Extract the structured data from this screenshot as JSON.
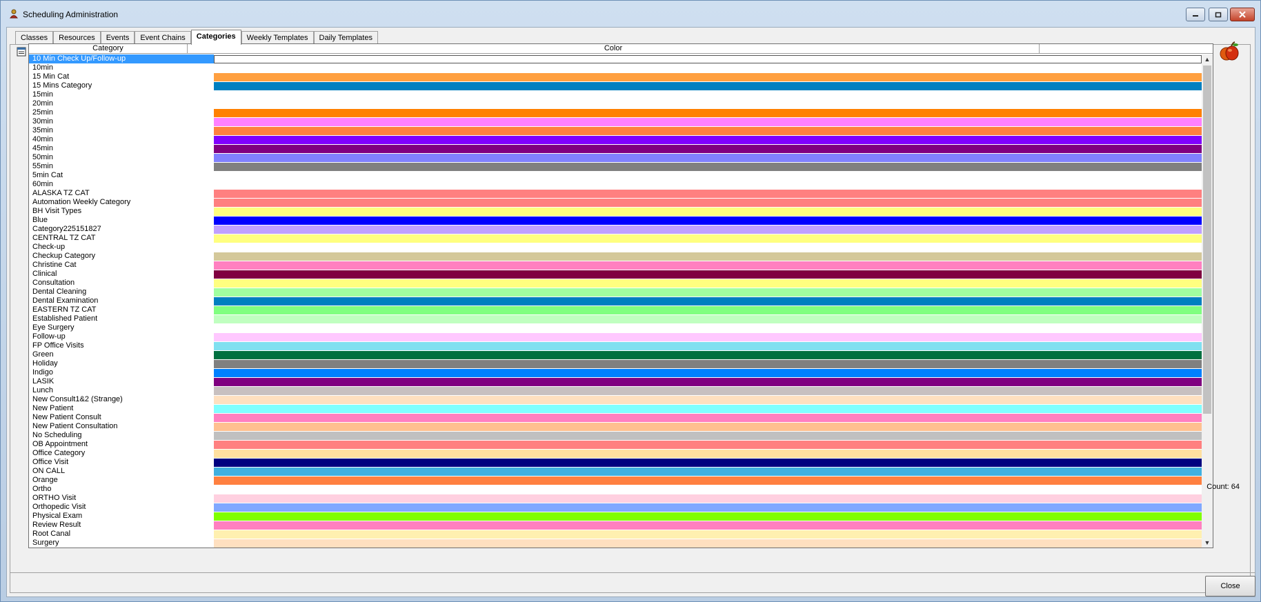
{
  "window": {
    "title": "Scheduling Administration"
  },
  "tabs": [
    {
      "label": "Classes",
      "active": false
    },
    {
      "label": "Resources",
      "active": false
    },
    {
      "label": "Events",
      "active": false
    },
    {
      "label": "Event Chains",
      "active": false
    },
    {
      "label": "Categories",
      "active": true
    },
    {
      "label": "Weekly Templates",
      "active": false
    },
    {
      "label": "Daily Templates",
      "active": false
    }
  ],
  "grid": {
    "columns": [
      "Category",
      "Color"
    ],
    "selected_index": 0,
    "rows": [
      {
        "name": "10 Min Check Up/Follow-up",
        "color": "#ffffff"
      },
      {
        "name": "10min",
        "color": "#ffffff"
      },
      {
        "name": "15 Min Cat",
        "color": "#ffa040"
      },
      {
        "name": "15 Mins Category",
        "color": "#0080c0"
      },
      {
        "name": "15min",
        "color": "#ffffff"
      },
      {
        "name": "20min",
        "color": "#ffffff"
      },
      {
        "name": "25min",
        "color": "#ff8000"
      },
      {
        "name": "30min",
        "color": "#ff80ff"
      },
      {
        "name": "35min",
        "color": "#ff8040"
      },
      {
        "name": "40min",
        "color": "#8000ff"
      },
      {
        "name": "45min",
        "color": "#800080"
      },
      {
        "name": "50min",
        "color": "#8080ff"
      },
      {
        "name": "55min",
        "color": "#808080"
      },
      {
        "name": "5min Cat",
        "color": "#ffffff"
      },
      {
        "name": "60min",
        "color": "#ffffff"
      },
      {
        "name": "ALASKA TZ CAT",
        "color": "#ff8080"
      },
      {
        "name": "Automation Weekly Category",
        "color": "#ff8080"
      },
      {
        "name": "BH Visit Types",
        "color": "#ffff80"
      },
      {
        "name": "Blue",
        "color": "#0000ff"
      },
      {
        "name": "Category225151827",
        "color": "#c0a0ff"
      },
      {
        "name": "CENTRAL TZ CAT",
        "color": "#ffff80"
      },
      {
        "name": "Check-up",
        "color": "#ffffff"
      },
      {
        "name": "Checkup Category",
        "color": "#d4c89a"
      },
      {
        "name": "Christine Cat",
        "color": "#ff80c0"
      },
      {
        "name": "Clinical",
        "color": "#800040"
      },
      {
        "name": "Consultation",
        "color": "#ffff80"
      },
      {
        "name": "Dental Cleaning",
        "color": "#a0ffa0"
      },
      {
        "name": "Dental Examination",
        "color": "#0080c0"
      },
      {
        "name": "EASTERN TZ CAT",
        "color": "#80ff80"
      },
      {
        "name": "Established Patient",
        "color": "#c0ffc0"
      },
      {
        "name": "Eye Surgery",
        "color": "#ffffff"
      },
      {
        "name": "Follow-up",
        "color": "#ffc8ff"
      },
      {
        "name": "FP Office Visits",
        "color": "#80e0f0"
      },
      {
        "name": "Green",
        "color": "#007040"
      },
      {
        "name": "Holiday",
        "color": "#808080"
      },
      {
        "name": "Indigo",
        "color": "#0080ff"
      },
      {
        "name": "LASIK",
        "color": "#800080"
      },
      {
        "name": "Lunch",
        "color": "#c8c0c0"
      },
      {
        "name": "New Consult1&2 (Strange)",
        "color": "#ffe0c0"
      },
      {
        "name": "New Patient",
        "color": "#80ffff"
      },
      {
        "name": "New Patient Consult",
        "color": "#ff80c0"
      },
      {
        "name": "New Patient Consultation",
        "color": "#ffc090"
      },
      {
        "name": "No Scheduling",
        "color": "#c0c0c0"
      },
      {
        "name": "OB Appointment",
        "color": "#ff8080"
      },
      {
        "name": "Office Category",
        "color": "#ffe0a0"
      },
      {
        "name": "Office Visit",
        "color": "#000080"
      },
      {
        "name": "ON CALL",
        "color": "#40b0e0"
      },
      {
        "name": "Orange",
        "color": "#ff8040"
      },
      {
        "name": "Ortho",
        "color": "#ffffff"
      },
      {
        "name": "ORTHO Visit",
        "color": "#ffd0e0"
      },
      {
        "name": "Orthopedic Visit",
        "color": "#80a8ff"
      },
      {
        "name": "Physical Exam",
        "color": "#80ff00"
      },
      {
        "name": "Review Result",
        "color": "#ff80c0"
      },
      {
        "name": "Root Canal",
        "color": "#fff0b0"
      },
      {
        "name": "Surgery",
        "color": "#ffe0c0"
      }
    ]
  },
  "status": {
    "count_text": "Count: 64"
  },
  "footer": {
    "close_label": "Close"
  },
  "icons": {
    "app": "person-icon",
    "grid_corner": "grid-settings-icon",
    "fruit": "apple-icon"
  }
}
